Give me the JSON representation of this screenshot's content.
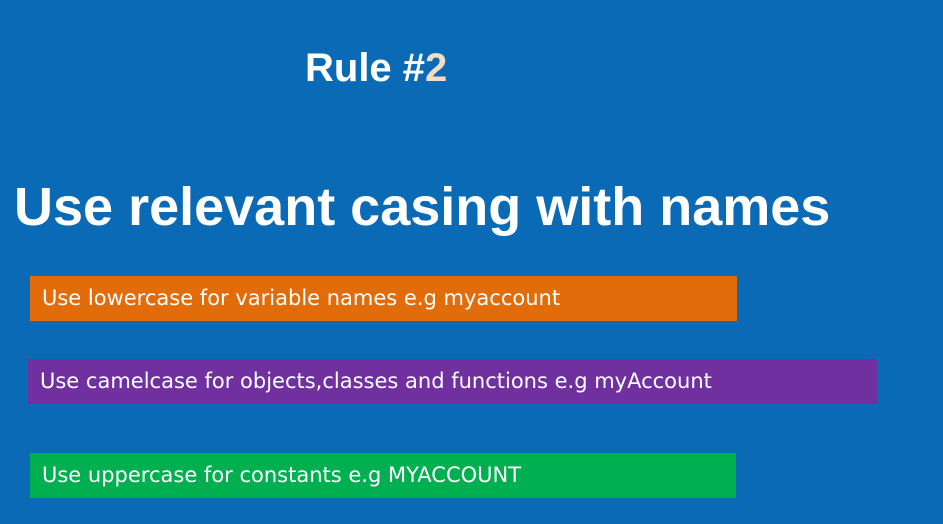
{
  "slide": {
    "background_color": "#0a6ab6",
    "rule_label": "Rule #",
    "rule_number": "2",
    "rule_number_color": "#f4dcc6",
    "headline": "Use relevant casing with names",
    "rules": [
      {
        "text": "Use lowercase for variable names e.g myaccount",
        "color": "#e36c0a"
      },
      {
        "text": "Use camelcase for objects,classes and functions e.g myAccount",
        "color": "#7030a0"
      },
      {
        "text": "Use uppercase for constants e.g MYACCOUNT",
        "color": "#00b050"
      }
    ]
  }
}
